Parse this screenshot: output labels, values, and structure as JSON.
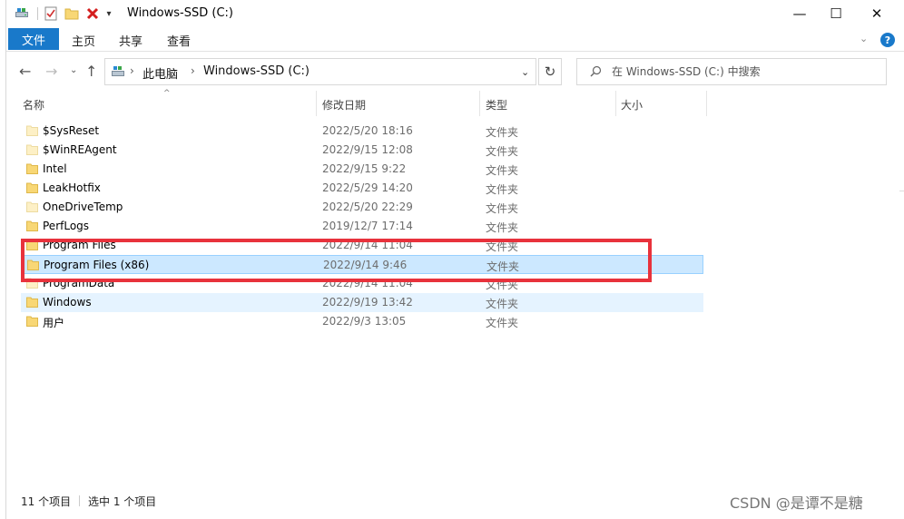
{
  "window": {
    "title": "Windows-SSD (C:)",
    "controls": {
      "minimize": "—",
      "maximize": "☐",
      "close": "✕"
    }
  },
  "quick_access": {
    "customize_arrow": "▾"
  },
  "ribbon": {
    "tabs": [
      "文件",
      "主页",
      "共享",
      "查看"
    ],
    "expand_icon": "⌄",
    "help": "?"
  },
  "nav": {
    "back": "←",
    "forward": "→",
    "recent": "⌄",
    "up": "↑",
    "breadcrumb": [
      "此电脑",
      "Windows-SSD (C:)"
    ],
    "crumb_separator": "›",
    "dropdown": "⌄",
    "refresh": "↻",
    "search_placeholder": "在 Windows-SSD (C:) 中搜索"
  },
  "columns": [
    "名称",
    "修改日期",
    "类型",
    "大小"
  ],
  "sort_indicator": "^",
  "files": [
    {
      "name": "$SysReset",
      "date": "2022/5/20 18:16",
      "type": "文件夹",
      "state": "normal",
      "style": "light"
    },
    {
      "name": "$WinREAgent",
      "date": "2022/9/15 12:08",
      "type": "文件夹",
      "state": "normal",
      "style": "light"
    },
    {
      "name": "Intel",
      "date": "2022/9/15 9:22",
      "type": "文件夹",
      "state": "normal",
      "style": "normal"
    },
    {
      "name": "LeakHotfix",
      "date": "2022/5/29 14:20",
      "type": "文件夹",
      "state": "normal",
      "style": "normal"
    },
    {
      "name": "OneDriveTemp",
      "date": "2022/5/20 22:29",
      "type": "文件夹",
      "state": "normal",
      "style": "light"
    },
    {
      "name": "PerfLogs",
      "date": "2019/12/7 17:14",
      "type": "文件夹",
      "state": "normal",
      "style": "normal"
    },
    {
      "name": "Program Files",
      "date": "2022/9/14 11:04",
      "type": "文件夹",
      "state": "normal",
      "style": "normal"
    },
    {
      "name": "Program Files (x86)",
      "date": "2022/9/14 9:46",
      "type": "文件夹",
      "state": "selected",
      "style": "normal"
    },
    {
      "name": "ProgramData",
      "date": "2022/9/14 11:04",
      "type": "文件夹",
      "state": "normal",
      "style": "light"
    },
    {
      "name": "Windows",
      "date": "2022/9/19 13:42",
      "type": "文件夹",
      "state": "hover",
      "style": "normal"
    },
    {
      "name": "用户",
      "date": "2022/9/3 13:05",
      "type": "文件夹",
      "state": "normal",
      "style": "normal"
    }
  ],
  "status": {
    "count": "11 个项目",
    "selection": "选中 1 个项目"
  },
  "watermark": "CSDN @是谭不是糖",
  "colors": {
    "accent": "#1979ca",
    "selected_bg": "#cce8ff",
    "hover_bg": "#e5f3ff",
    "highlight_box": "#e8323c",
    "folder": "#f8d775"
  }
}
